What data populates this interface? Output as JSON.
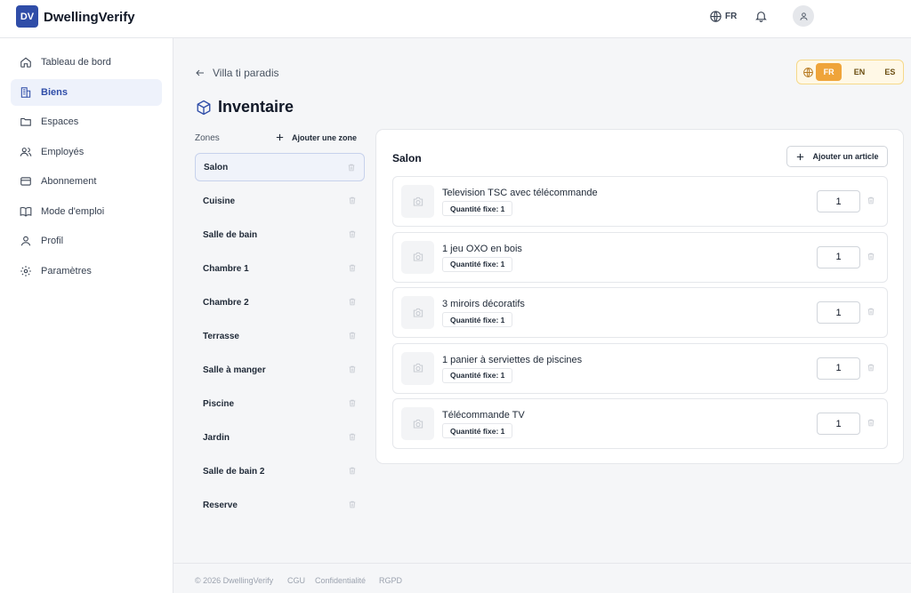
{
  "app": {
    "logo_initials": "DV",
    "name": "DwellingVerify"
  },
  "header": {
    "language": "FR",
    "icons": [
      "globe-icon",
      "bell-icon",
      "user-icon"
    ]
  },
  "sidebar": {
    "items": [
      {
        "label": "Tableau de bord",
        "icon": "home-icon",
        "active": false
      },
      {
        "label": "Biens",
        "icon": "building-icon",
        "active": true
      },
      {
        "label": "Espaces",
        "icon": "folder-icon",
        "active": false
      },
      {
        "label": "Employés",
        "icon": "users-icon",
        "active": false
      },
      {
        "label": "Abonnement",
        "icon": "credit-card-icon",
        "active": false
      },
      {
        "label": "Mode d'emploi",
        "icon": "book-icon",
        "active": false
      },
      {
        "label": "Profil",
        "icon": "user-icon",
        "active": false
      },
      {
        "label": "Paramètres",
        "icon": "gear-icon",
        "active": false
      }
    ]
  },
  "main": {
    "back_label": "Villa ti paradis",
    "title": "Inventaire",
    "languages": [
      {
        "code": "FR",
        "active": true
      },
      {
        "code": "EN",
        "active": false
      },
      {
        "code": "ES",
        "active": false
      }
    ],
    "zones_label": "Zones",
    "add_zone_label": "Ajouter une zone",
    "zones": [
      {
        "name": "Salon",
        "active": true
      },
      {
        "name": "Cuisine",
        "active": false
      },
      {
        "name": "Salle de bain",
        "active": false
      },
      {
        "name": "Chambre 1",
        "active": false
      },
      {
        "name": "Chambre 2",
        "active": false
      },
      {
        "name": "Terrasse",
        "active": false
      },
      {
        "name": "Salle à manger",
        "active": false
      },
      {
        "name": "Piscine",
        "active": false
      },
      {
        "name": "Jardin",
        "active": false
      },
      {
        "name": "Salle de bain 2",
        "active": false
      },
      {
        "name": "Reserve",
        "active": false
      }
    ],
    "panel": {
      "title": "Salon",
      "add_item_label": "Ajouter un article",
      "items": [
        {
          "name": "Television TSC avec télécommande",
          "badge": "Quantité fixe: 1",
          "quantity": "1"
        },
        {
          "name": "1 jeu OXO en bois",
          "badge": "Quantité fixe: 1",
          "quantity": "1"
        },
        {
          "name": "3 miroirs décoratifs",
          "badge": "Quantité fixe: 1",
          "quantity": "1"
        },
        {
          "name": "1 panier à serviettes de piscines",
          "badge": "Quantité fixe: 1",
          "quantity": "1"
        },
        {
          "name": "Télécommande TV",
          "badge": "Quantité fixe: 1",
          "quantity": "1"
        }
      ]
    }
  },
  "footer": {
    "copyright": "© 2026 DwellingVerify",
    "links": [
      "CGU",
      "Confidentialité",
      "RGPD"
    ]
  },
  "colors": {
    "brand": "#2f4da8",
    "accent": "#efa43a",
    "active_bg": "#eef2fb"
  }
}
